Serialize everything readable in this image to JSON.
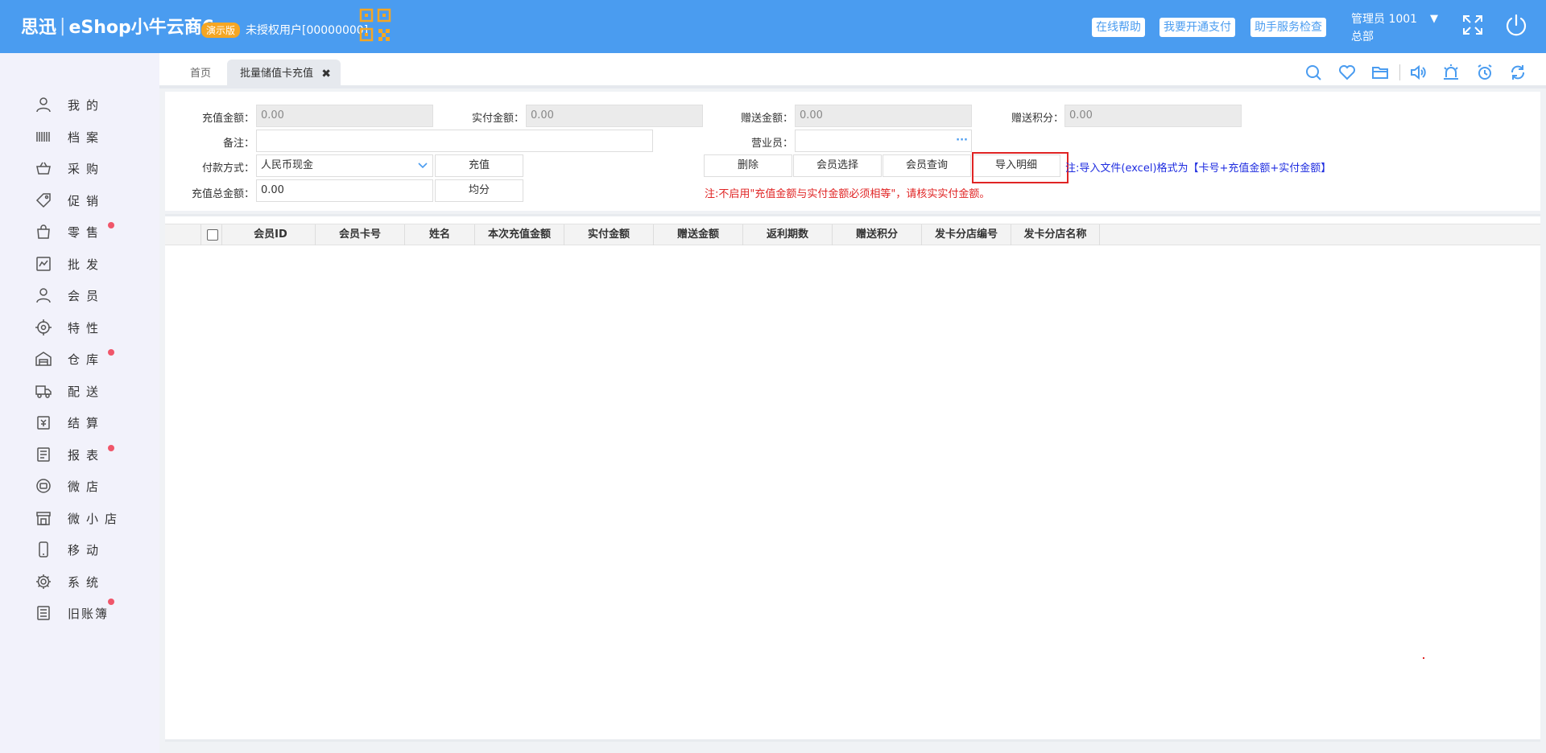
{
  "header": {
    "brand_name": "思迅",
    "brand_product": "eShop小牛云商6",
    "demo_badge": "演示版",
    "license_text": "未授权用户[00000000]",
    "buttons": {
      "online_help": "在线帮助",
      "open_payment": "我要开通支付",
      "service_check": "助手服务检查"
    },
    "user_role_id": "管理员 1001",
    "user_branch": "总部",
    "caret": "▼"
  },
  "sidebar": {
    "items": [
      {
        "label": "我的",
        "icon": "user-icon",
        "dot": false
      },
      {
        "label": "档案",
        "icon": "barcode-icon",
        "dot": false
      },
      {
        "label": "采购",
        "icon": "basket-icon",
        "dot": false
      },
      {
        "label": "促销",
        "icon": "tag-icon",
        "dot": false
      },
      {
        "label": "零售",
        "icon": "shopping-bag-icon",
        "dot": true
      },
      {
        "label": "批发",
        "icon": "wholesale-icon",
        "dot": false
      },
      {
        "label": "会员",
        "icon": "member-icon",
        "dot": false
      },
      {
        "label": "特性",
        "icon": "target-icon",
        "dot": false
      },
      {
        "label": "仓库",
        "icon": "warehouse-icon",
        "dot": true
      },
      {
        "label": "配送",
        "icon": "truck-icon",
        "dot": false
      },
      {
        "label": "结算",
        "icon": "settlement-icon",
        "dot": false
      },
      {
        "label": "报表",
        "icon": "report-icon",
        "dot": true
      },
      {
        "label": "微店",
        "icon": "micro-shop-icon",
        "dot": false
      },
      {
        "label": "微小店",
        "icon": "store-icon",
        "dot": false
      },
      {
        "label": "移动",
        "icon": "mobile-icon",
        "dot": false
      },
      {
        "label": "系统",
        "icon": "gear-icon",
        "dot": false
      },
      {
        "label": "旧账簿",
        "icon": "ledger-icon",
        "dot": true
      }
    ]
  },
  "tabs": {
    "home": "首页",
    "active": "批量储值卡充值",
    "close": "✖"
  },
  "form": {
    "recharge_amount": {
      "label": "充值金额：",
      "value": "0.00"
    },
    "paid_amount": {
      "label": "实付金额：",
      "value": "0.00"
    },
    "gift_amount": {
      "label": "赠送金额：",
      "value": "0.00"
    },
    "gift_points": {
      "label": "赠送积分：",
      "value": "0.00"
    },
    "remark": {
      "label": "备注：",
      "value": ""
    },
    "salesperson": {
      "label": "营业员：",
      "value": "",
      "more": "···"
    },
    "payment_method": {
      "label": "付款方式：",
      "value": "人民币现金"
    },
    "total_recharge": {
      "label": "充值总金额：",
      "value": "0.00"
    },
    "buttons": {
      "recharge": "充值",
      "average": "均分",
      "delete": "删除",
      "member_select": "会员选择",
      "member_query": "会员查询",
      "import_detail": "导入明细"
    },
    "note_import": "注:导入文件(excel)格式为【卡号+充值金额+实付金额】",
    "note_warning": "注:不启用\"充值金额与实付金额必须相等\"，请核实实付金额。"
  },
  "table": {
    "columns": [
      "会员ID",
      "会员卡号",
      "姓名",
      "本次充值金额",
      "实付金额",
      "赠送金额",
      "返利期数",
      "赠送积分",
      "发卡分店编号",
      "发卡分店名称"
    ],
    "rows": []
  },
  "colors": {
    "header_bg": "#4a9cf0",
    "accent": "#4a9cf0",
    "badge": "#f5a623",
    "alert_dot": "#f0566a",
    "highlight_border": "#e02424",
    "note_blue": "#1f2de0"
  }
}
